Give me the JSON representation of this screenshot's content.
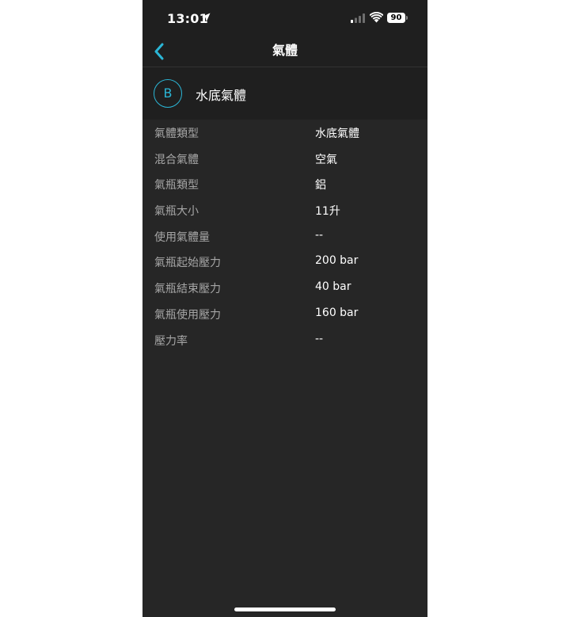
{
  "status_bar": {
    "time": "13:01",
    "battery": "90"
  },
  "nav": {
    "title": "氣體"
  },
  "gas": {
    "badge": "B",
    "name": "水底氣體"
  },
  "details": [
    {
      "label": "氣體類型",
      "value": "水底氣體"
    },
    {
      "label": "混合氣體",
      "value": "空氣"
    },
    {
      "label": "氣瓶類型",
      "value": "鋁"
    },
    {
      "label": "氣瓶大小",
      "value": "11升"
    },
    {
      "label": "使用氣體量",
      "value": "--"
    },
    {
      "label": "氣瓶起始壓力",
      "value": "200 bar"
    },
    {
      "label": "氣瓶結束壓力",
      "value": "40 bar"
    },
    {
      "label": "氣瓶使用壓力",
      "value": "160 bar"
    },
    {
      "label": "壓力率",
      "value": "--"
    }
  ],
  "colors": {
    "accent": "#2bb6d6",
    "background": "#262626",
    "header_background": "#1f1f1f",
    "label_text": "#a6a6a6"
  }
}
